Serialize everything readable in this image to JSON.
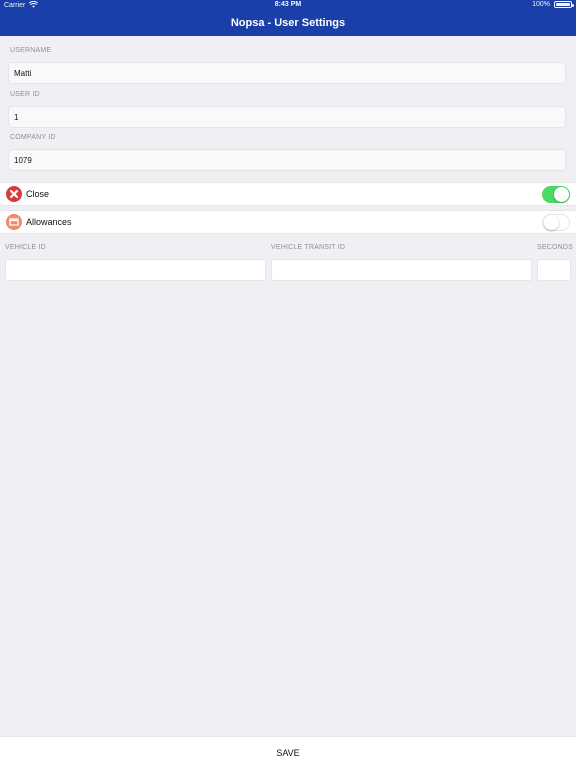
{
  "status": {
    "carrier": "Carrier",
    "time": "8:43 PM",
    "battery": "100%",
    "battery_level": 1.0
  },
  "header": {
    "title": "Nopsa - User Settings"
  },
  "fields": {
    "username": {
      "label": "USERNAME",
      "value": "Matti"
    },
    "user_id": {
      "label": "USER ID",
      "value": "1"
    },
    "company_id": {
      "label": "COMPANY ID",
      "value": "1079"
    }
  },
  "toggles": [
    {
      "label": "Close",
      "state": "on",
      "icon": "close-circle-icon",
      "icon_color": "#d63b3b"
    },
    {
      "label": "Allowances",
      "state": "off",
      "icon": "document-icon",
      "icon_color": "#f08a6a"
    }
  ],
  "vehicle": {
    "vehicle_id_label": "VEHICLE ID",
    "vehicle_transit_id_label": "VEHICLE TRANSIT ID",
    "seconds_label": "SECONDS",
    "vehicle_id_value": "",
    "vehicle_transit_id_value": "",
    "seconds_value": ""
  },
  "footer": {
    "save_label": "SAVE"
  },
  "colors": {
    "nav_bar": "#1a3fa8",
    "toggle_on": "#4cd964",
    "background": "#efeff4"
  }
}
